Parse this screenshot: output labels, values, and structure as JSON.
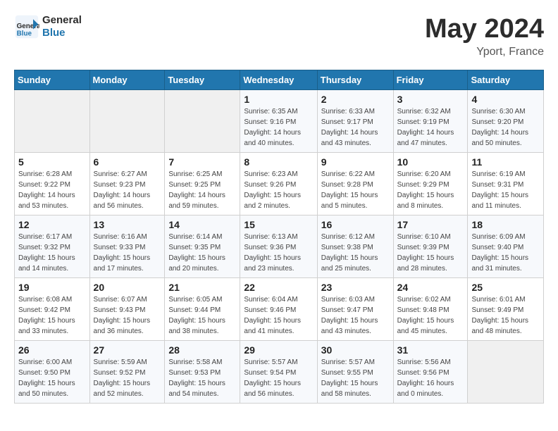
{
  "header": {
    "logo_line1": "General",
    "logo_line2": "Blue",
    "month_year": "May 2024",
    "location": "Yport, France"
  },
  "weekdays": [
    "Sunday",
    "Monday",
    "Tuesday",
    "Wednesday",
    "Thursday",
    "Friday",
    "Saturday"
  ],
  "weeks": [
    [
      {
        "day": "",
        "info": ""
      },
      {
        "day": "",
        "info": ""
      },
      {
        "day": "",
        "info": ""
      },
      {
        "day": "1",
        "info": "Sunrise: 6:35 AM\nSunset: 9:16 PM\nDaylight: 14 hours\nand 40 minutes."
      },
      {
        "day": "2",
        "info": "Sunrise: 6:33 AM\nSunset: 9:17 PM\nDaylight: 14 hours\nand 43 minutes."
      },
      {
        "day": "3",
        "info": "Sunrise: 6:32 AM\nSunset: 9:19 PM\nDaylight: 14 hours\nand 47 minutes."
      },
      {
        "day": "4",
        "info": "Sunrise: 6:30 AM\nSunset: 9:20 PM\nDaylight: 14 hours\nand 50 minutes."
      }
    ],
    [
      {
        "day": "5",
        "info": "Sunrise: 6:28 AM\nSunset: 9:22 PM\nDaylight: 14 hours\nand 53 minutes."
      },
      {
        "day": "6",
        "info": "Sunrise: 6:27 AM\nSunset: 9:23 PM\nDaylight: 14 hours\nand 56 minutes."
      },
      {
        "day": "7",
        "info": "Sunrise: 6:25 AM\nSunset: 9:25 PM\nDaylight: 14 hours\nand 59 minutes."
      },
      {
        "day": "8",
        "info": "Sunrise: 6:23 AM\nSunset: 9:26 PM\nDaylight: 15 hours\nand 2 minutes."
      },
      {
        "day": "9",
        "info": "Sunrise: 6:22 AM\nSunset: 9:28 PM\nDaylight: 15 hours\nand 5 minutes."
      },
      {
        "day": "10",
        "info": "Sunrise: 6:20 AM\nSunset: 9:29 PM\nDaylight: 15 hours\nand 8 minutes."
      },
      {
        "day": "11",
        "info": "Sunrise: 6:19 AM\nSunset: 9:31 PM\nDaylight: 15 hours\nand 11 minutes."
      }
    ],
    [
      {
        "day": "12",
        "info": "Sunrise: 6:17 AM\nSunset: 9:32 PM\nDaylight: 15 hours\nand 14 minutes."
      },
      {
        "day": "13",
        "info": "Sunrise: 6:16 AM\nSunset: 9:33 PM\nDaylight: 15 hours\nand 17 minutes."
      },
      {
        "day": "14",
        "info": "Sunrise: 6:14 AM\nSunset: 9:35 PM\nDaylight: 15 hours\nand 20 minutes."
      },
      {
        "day": "15",
        "info": "Sunrise: 6:13 AM\nSunset: 9:36 PM\nDaylight: 15 hours\nand 23 minutes."
      },
      {
        "day": "16",
        "info": "Sunrise: 6:12 AM\nSunset: 9:38 PM\nDaylight: 15 hours\nand 25 minutes."
      },
      {
        "day": "17",
        "info": "Sunrise: 6:10 AM\nSunset: 9:39 PM\nDaylight: 15 hours\nand 28 minutes."
      },
      {
        "day": "18",
        "info": "Sunrise: 6:09 AM\nSunset: 9:40 PM\nDaylight: 15 hours\nand 31 minutes."
      }
    ],
    [
      {
        "day": "19",
        "info": "Sunrise: 6:08 AM\nSunset: 9:42 PM\nDaylight: 15 hours\nand 33 minutes."
      },
      {
        "day": "20",
        "info": "Sunrise: 6:07 AM\nSunset: 9:43 PM\nDaylight: 15 hours\nand 36 minutes."
      },
      {
        "day": "21",
        "info": "Sunrise: 6:05 AM\nSunset: 9:44 PM\nDaylight: 15 hours\nand 38 minutes."
      },
      {
        "day": "22",
        "info": "Sunrise: 6:04 AM\nSunset: 9:46 PM\nDaylight: 15 hours\nand 41 minutes."
      },
      {
        "day": "23",
        "info": "Sunrise: 6:03 AM\nSunset: 9:47 PM\nDaylight: 15 hours\nand 43 minutes."
      },
      {
        "day": "24",
        "info": "Sunrise: 6:02 AM\nSunset: 9:48 PM\nDaylight: 15 hours\nand 45 minutes."
      },
      {
        "day": "25",
        "info": "Sunrise: 6:01 AM\nSunset: 9:49 PM\nDaylight: 15 hours\nand 48 minutes."
      }
    ],
    [
      {
        "day": "26",
        "info": "Sunrise: 6:00 AM\nSunset: 9:50 PM\nDaylight: 15 hours\nand 50 minutes."
      },
      {
        "day": "27",
        "info": "Sunrise: 5:59 AM\nSunset: 9:52 PM\nDaylight: 15 hours\nand 52 minutes."
      },
      {
        "day": "28",
        "info": "Sunrise: 5:58 AM\nSunset: 9:53 PM\nDaylight: 15 hours\nand 54 minutes."
      },
      {
        "day": "29",
        "info": "Sunrise: 5:57 AM\nSunset: 9:54 PM\nDaylight: 15 hours\nand 56 minutes."
      },
      {
        "day": "30",
        "info": "Sunrise: 5:57 AM\nSunset: 9:55 PM\nDaylight: 15 hours\nand 58 minutes."
      },
      {
        "day": "31",
        "info": "Sunrise: 5:56 AM\nSunset: 9:56 PM\nDaylight: 16 hours\nand 0 minutes."
      },
      {
        "day": "",
        "info": ""
      }
    ]
  ]
}
